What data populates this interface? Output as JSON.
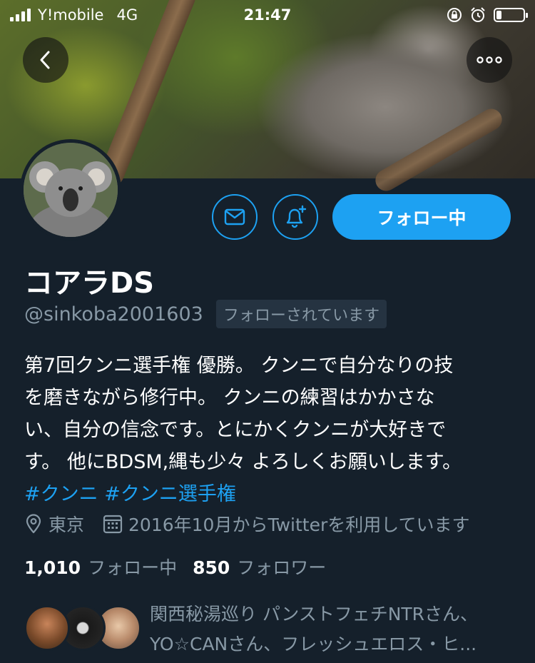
{
  "status_bar": {
    "carrier": "Y!mobile",
    "network": "4G",
    "time": "21:47"
  },
  "profile": {
    "name": "コアラDS",
    "handle": "@sinkoba2001603",
    "follows_you": "フォローされています",
    "follow_button_label": "フォロー中",
    "bio_lines": [
      "第7回クンニ選手権 優勝。 クンニで自分なりの技",
      "を磨きながら修行中。 クンニの練習はかかさな",
      "い、自分の信念です。とにかくクンニが大好きで",
      "す。 他にBDSM,縄も少々 よろしくお願いします。"
    ],
    "hashtags": "#クンニ #クンニ選手権",
    "location": "東京",
    "joined": "2016年10月からTwitterを利用しています",
    "following_count": "1,010",
    "following_label": "フォロー中",
    "followers_count": "850",
    "followers_label": "フォロワー",
    "followed_by_lines": [
      "関西秘湯巡り パンストフェチNTRさん、",
      "YO☆CANさん、フレッシュエロス・ヒ..."
    ]
  },
  "colors": {
    "background": "#15202b",
    "accent": "#1da1f2",
    "secondary_text": "#8899a6"
  },
  "icons": {
    "back": "chevron-left-icon",
    "more": "more-horizontal-icon",
    "message": "envelope-icon",
    "notify": "bell-plus-icon",
    "location": "location-pin-icon",
    "calendar": "calendar-icon"
  }
}
